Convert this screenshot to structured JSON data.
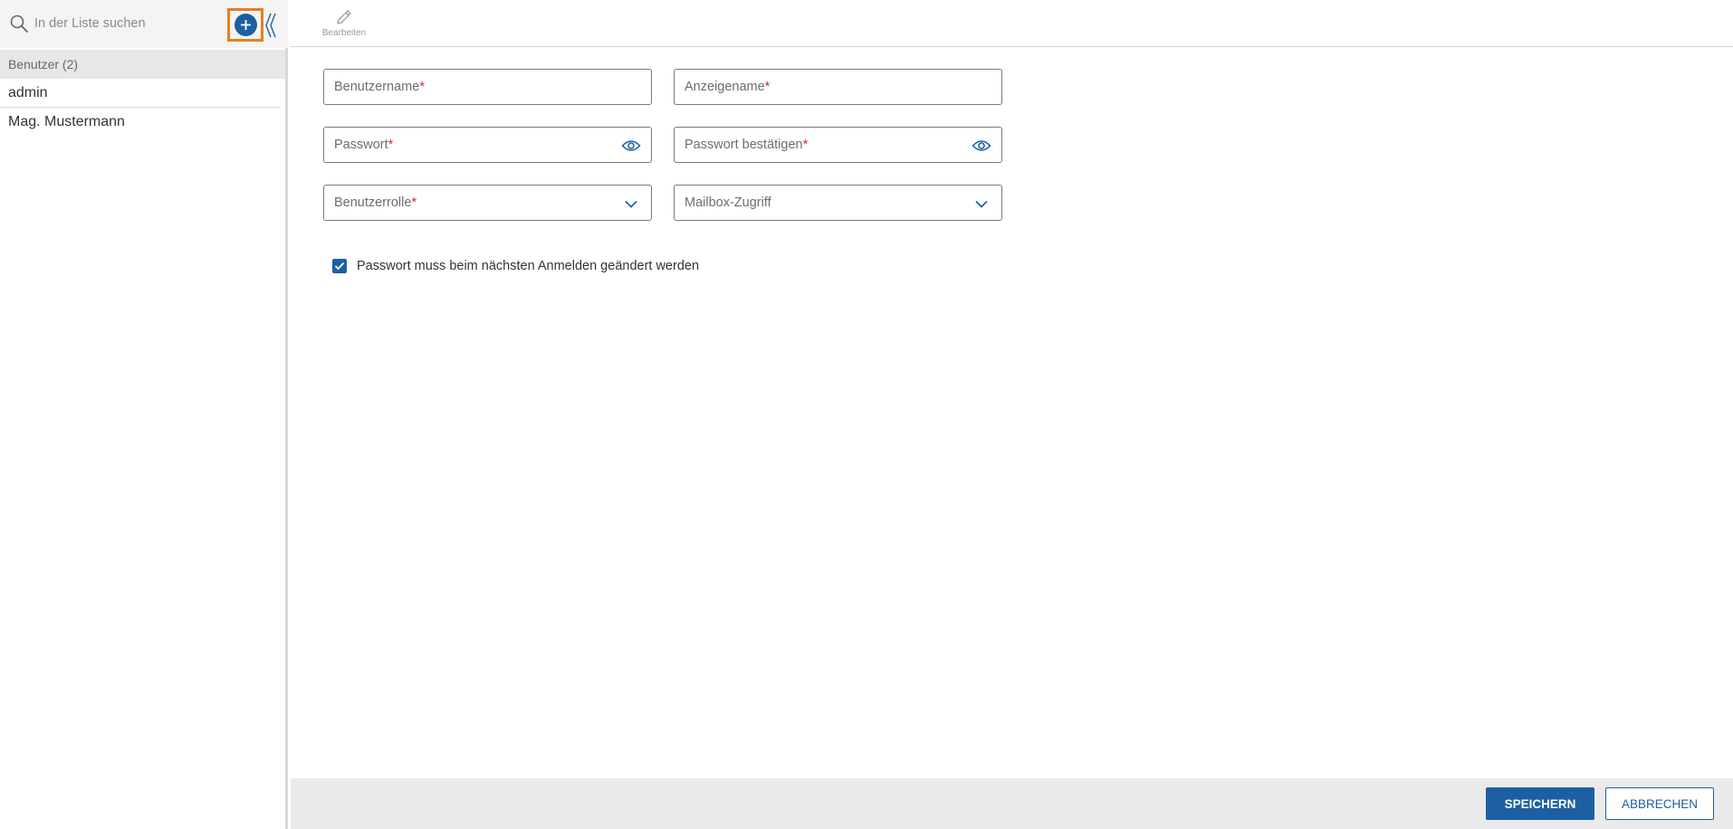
{
  "sidebar": {
    "search_placeholder": "In der Liste suchen",
    "group_header": "Benutzer (2)",
    "users": [
      "admin",
      "Mag. Mustermann"
    ]
  },
  "toolbar": {
    "edit_label": "Bearbeiten"
  },
  "form": {
    "username_label": "Benutzername",
    "display_name_label": "Anzeigename",
    "password_label": "Passwort",
    "password_confirm_label": "Passwort bestätigen",
    "role_label": "Benutzerrolle",
    "mailbox_label": "Mailbox-Zugriff",
    "required_marker": "*",
    "change_password_label": "Passwort muss beim nächsten Anmelden geändert werden",
    "change_password_checked": true
  },
  "footer": {
    "save_label": "SPEICHERN",
    "cancel_label": "ABBRECHEN"
  },
  "colors": {
    "accent": "#1d5fa3",
    "highlight": "#e87e1e",
    "required": "#d62b2b"
  }
}
